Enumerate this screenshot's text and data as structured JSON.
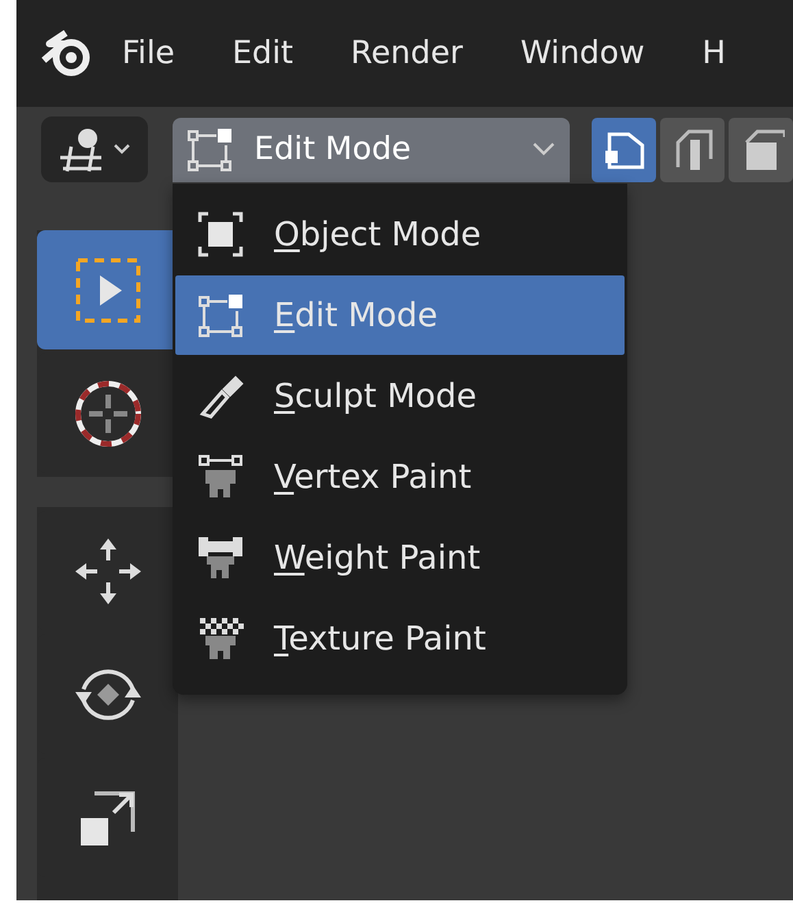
{
  "menubar": {
    "items": [
      "File",
      "Edit",
      "Render",
      "Window",
      "H"
    ]
  },
  "header": {
    "mode_dropdown": {
      "value": "Edit Mode"
    },
    "select_modes": [
      {
        "kind": "vertex",
        "selected": true
      },
      {
        "kind": "edge",
        "selected": false
      },
      {
        "kind": "face",
        "selected": false
      }
    ]
  },
  "mode_menu": {
    "items": [
      {
        "label": "Object Mode",
        "kind": "object",
        "selected": false
      },
      {
        "label": "Edit Mode",
        "kind": "edit",
        "selected": true
      },
      {
        "label": "Sculpt Mode",
        "kind": "sculpt",
        "selected": false
      },
      {
        "label": "Vertex Paint",
        "kind": "vertex_paint",
        "selected": false
      },
      {
        "label": "Weight Paint",
        "kind": "weight_paint",
        "selected": false
      },
      {
        "label": "Texture Paint",
        "kind": "texture_paint",
        "selected": false
      }
    ]
  },
  "toolbar": {
    "tools": [
      {
        "kind": "select_box",
        "selected": true
      },
      {
        "kind": "cursor",
        "selected": false
      },
      {
        "kind": "move",
        "selected": false
      },
      {
        "kind": "rotate",
        "selected": false
      },
      {
        "kind": "scale",
        "selected": false
      }
    ]
  }
}
